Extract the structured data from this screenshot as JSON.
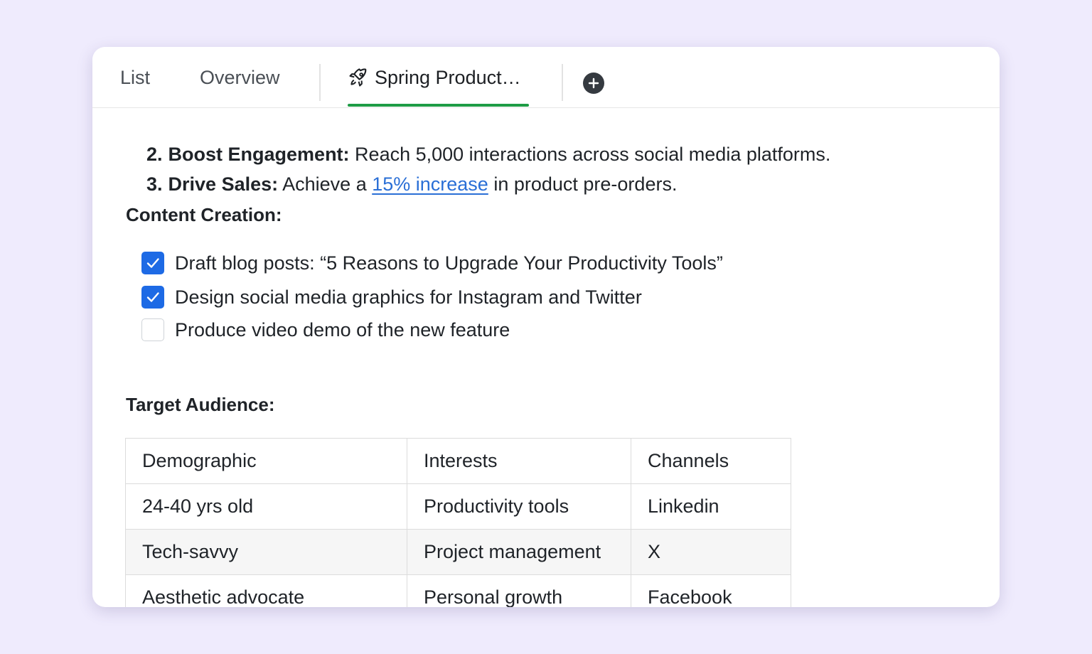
{
  "tabs": {
    "list": "List",
    "overview": "Overview",
    "active": "Spring Product…",
    "active_icon": "rocket-icon",
    "add_icon": "plus-circle-icon"
  },
  "goals": [
    {
      "num": "2.",
      "bold": "Boost Engagement:",
      "text": " Reach 5,000 interactions across social media platforms."
    },
    {
      "num": "3.",
      "bold": "Drive Sales:",
      "pre": " Achieve a ",
      "link": "15% increase",
      "post": " in product pre-orders."
    }
  ],
  "content_creation": {
    "heading": "Content Creation:",
    "tasks": [
      {
        "label": "Draft blog posts: “5 Reasons to Upgrade Your Productivity Tools”",
        "checked": true
      },
      {
        "label": "Design social media graphics for Instagram and Twitter",
        "checked": true
      },
      {
        "label": "Produce video demo of the new feature",
        "checked": false
      }
    ]
  },
  "target_audience": {
    "heading": "Target Audience:",
    "columns": [
      "Demographic",
      "Interests",
      "Channels"
    ],
    "rows": [
      [
        "24-40 yrs old",
        "Productivity tools",
        "Linkedin"
      ],
      [
        "Tech-savvy",
        "Project management",
        "X"
      ],
      [
        "Aesthetic advocate",
        "Personal growth",
        "Facebook"
      ]
    ]
  },
  "colors": {
    "background": "#efebfd",
    "accent_green": "#1e9c45",
    "checkbox_blue": "#1d6ae5",
    "link_blue": "#2a6fd6"
  }
}
